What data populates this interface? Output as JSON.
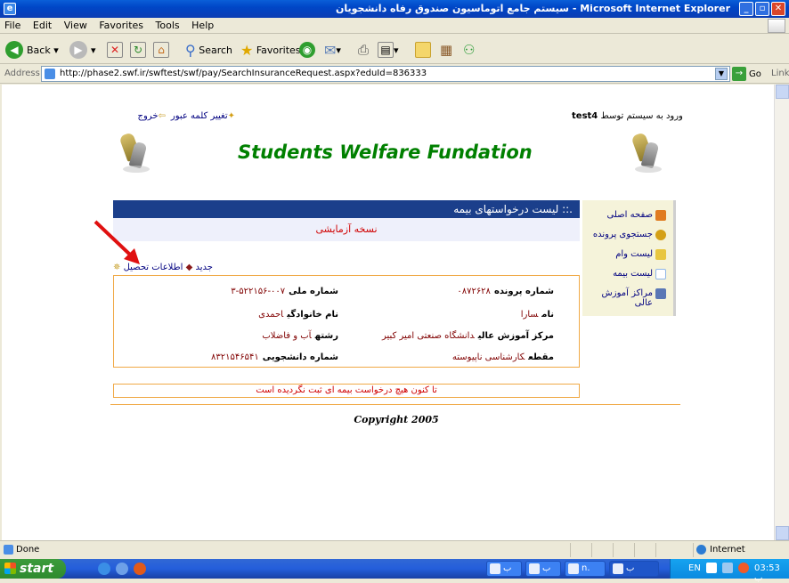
{
  "window": {
    "title": "سیستم جامع اتوماسیون صندوق رفاه دانشجویان - Microsoft Internet Explorer"
  },
  "menu": [
    "File",
    "Edit",
    "View",
    "Favorites",
    "Tools",
    "Help"
  ],
  "toolbar": {
    "back": "Back",
    "search": "Search",
    "favorites": "Favorites"
  },
  "address": {
    "label": "Address",
    "url": "http://phase2.swf.ir/swftest/swf/pay/SearchInsuranceRequest.aspx?eduId=836333",
    "go": "Go",
    "links": "Link"
  },
  "page": {
    "user_prefix": "ورود به سیستم توسط",
    "user": "test4",
    "change_password": "تغییر کلمه عبور",
    "logout": "خروج",
    "site_title": "Students Welfare Fundation",
    "list_title": ".:: لیست درخواستهای بیمه",
    "version_note": "نسخه آزمایشی",
    "side_menu": [
      {
        "label": "صفحه اصلی",
        "icon": "home-icon",
        "color": "#e07b20"
      },
      {
        "label": "جستجوی پرونده",
        "icon": "search-icon",
        "color": "#d4a017"
      },
      {
        "label": "لیست وام",
        "icon": "folder-icon",
        "color": "#e8c640"
      },
      {
        "label": "لیست بیمه",
        "icon": "document-icon",
        "color": "#8fb6e8"
      },
      {
        "label": "مراکز آموزش عالی",
        "icon": "building-icon",
        "color": "#5a77b5"
      }
    ],
    "new_label": "جدید",
    "education_info": "اطلاعات تحصیل",
    "fields": {
      "file_no_label": "شماره پرونده",
      "file_no": "۰۸۷۲۶۲۸",
      "national_id_label": "شماره ملی",
      "national_id": "۰۰۷-۵۲۲۱۵۶-۳",
      "first_name_label": "نام",
      "first_name": "سارا",
      "last_name_label": "نام خانوادگی",
      "last_name": "احمدی",
      "center_label": "مرکز آموزش عالی",
      "center": "دانشگاه صنعتی امیر کبیر",
      "major_label": "رشته",
      "major": "آب و فاضلاب",
      "degree_label": "مقطع",
      "degree": "کارشناسی ناپیوسته",
      "student_no_label": "شماره دانشجویی",
      "student_no": "۸۳۲۱۵۴۶۵۴۱"
    },
    "notice": "تا کنون هیچ درخواست بیمه ای ثبت نگردیده است",
    "copyright": "Copyright 2005"
  },
  "status": {
    "done": "Done",
    "zone": "Internet"
  },
  "taskbar": {
    "start": "start",
    "tasks": [
      "ب",
      "ب",
      "n.",
      "ب"
    ],
    "lang": "EN",
    "time": "03:53 ب"
  }
}
